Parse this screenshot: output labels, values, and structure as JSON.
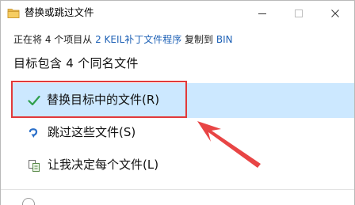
{
  "window": {
    "title": "替换或跳过文件",
    "controls": {
      "minimize": "minimize-icon",
      "maximize": "maximize-icon",
      "close": "close-icon"
    }
  },
  "info": {
    "prefix": "正在将 4 个项目从 ",
    "source": "2 KEIL补丁文件程序",
    "middle": " 复制到 ",
    "destination": "BIN"
  },
  "heading": "目标包含 4 个同名文件",
  "options": [
    {
      "label": "替换目标中的文件(R)",
      "icon": "checkmark-icon",
      "selected": true
    },
    {
      "label": "跳过这些文件(S)",
      "icon": "skip-arrow-icon",
      "selected": false
    },
    {
      "label": "让我决定每个文件(L)",
      "icon": "file-compare-icon",
      "selected": false
    }
  ],
  "colors": {
    "selected_background": "#cce8ff",
    "link": "#1f62b6",
    "annotation": "#e23a3a",
    "checkmark": "#2e9e4a"
  }
}
